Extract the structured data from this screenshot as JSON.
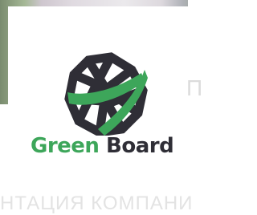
{
  "background": {
    "side_text": "П",
    "caption": "НТАЦИЯ КОМПАНИ"
  },
  "logo": {
    "word_green": "Green",
    "word_board": "Board",
    "colors": {
      "green": "#3da65a",
      "dark": "#2f2e36"
    },
    "icon": "green-board-logo-mark-icon"
  }
}
